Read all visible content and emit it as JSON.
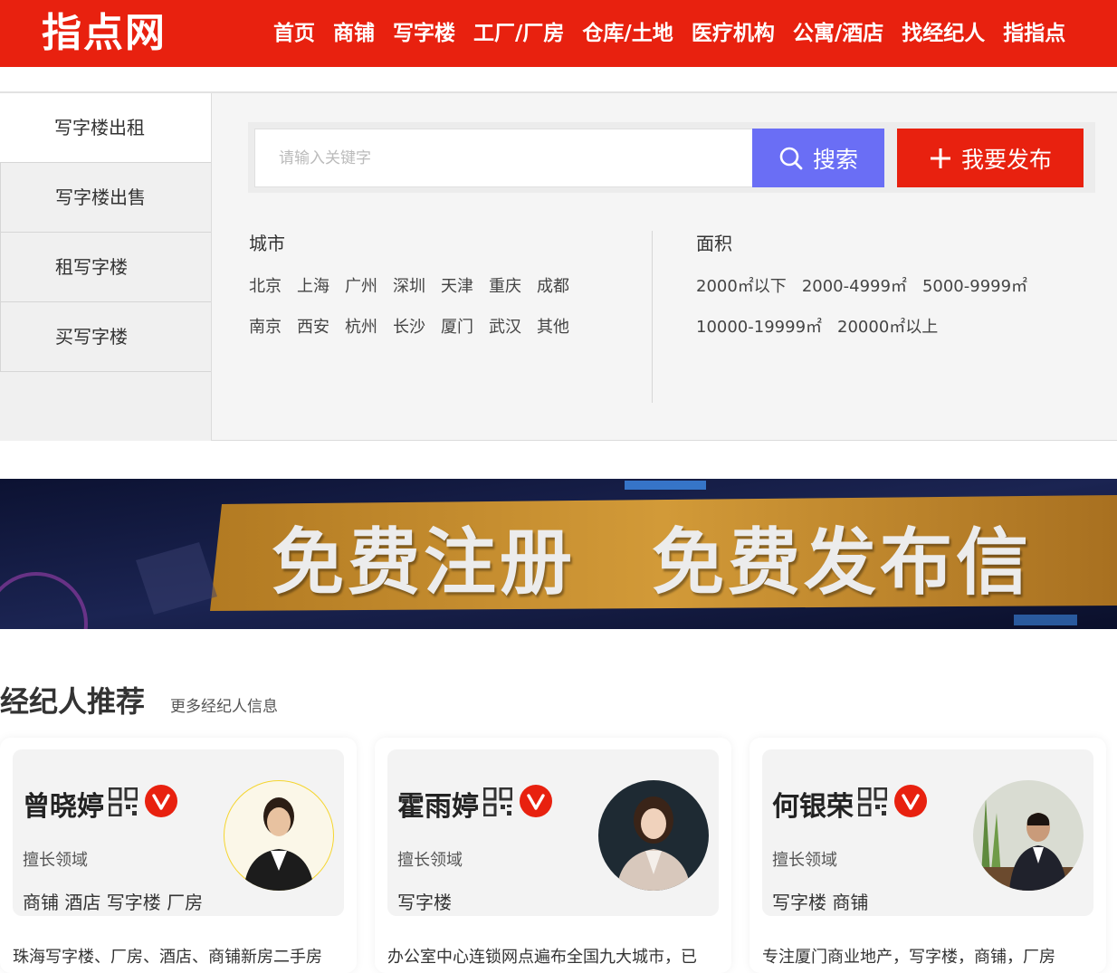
{
  "header": {
    "logo": "指点网",
    "nav": [
      "首页",
      "商铺",
      "写字楼",
      "工厂/厂房",
      "仓库/土地",
      "医疗机构",
      "公寓/酒店",
      "找经纪人",
      "指指点"
    ]
  },
  "sidebar": {
    "items": [
      "写字楼出租",
      "写字楼出售",
      "租写字楼",
      "买写字楼"
    ]
  },
  "search": {
    "placeholder": "请输入关键字",
    "search_label": "搜索",
    "publish_label": "我要发布"
  },
  "filters": {
    "city_title": "城市",
    "cities_row1": [
      "北京",
      "上海",
      "广州",
      "深圳",
      "天津",
      "重庆",
      "成都"
    ],
    "cities_row2": [
      "南京",
      "西安",
      "杭州",
      "长沙",
      "厦门",
      "武汉",
      "其他"
    ],
    "area_title": "面积",
    "areas_row1": [
      "2000㎡以下",
      "2000-4999㎡",
      "5000-9999㎡"
    ],
    "areas_row2": [
      "10000-19999㎡",
      "20000㎡以上"
    ]
  },
  "banner": {
    "text": "免费注册　免费发布信"
  },
  "agents": {
    "title": "经纪人推荐",
    "more": "更多经纪人信息",
    "skill_label": "擅长领域",
    "cards": [
      {
        "name": "曾晓婷",
        "skills": "商铺 酒店 写字楼 厂房",
        "desc": "珠海写字楼、厂房、酒店、商铺新房二手房"
      },
      {
        "name": "霍雨婷",
        "skills": "写字楼",
        "desc": "办公室中心连锁网点遍布全国九大城市，已"
      },
      {
        "name": "何银荣",
        "skills": "写字楼 商铺",
        "desc": "专注厦门商业地产，写字楼，商铺，厂房"
      }
    ]
  },
  "colors": {
    "brand_red": "#e8210f",
    "search_blue": "#6a6ef5",
    "banner_gold": "#c08a2c"
  }
}
